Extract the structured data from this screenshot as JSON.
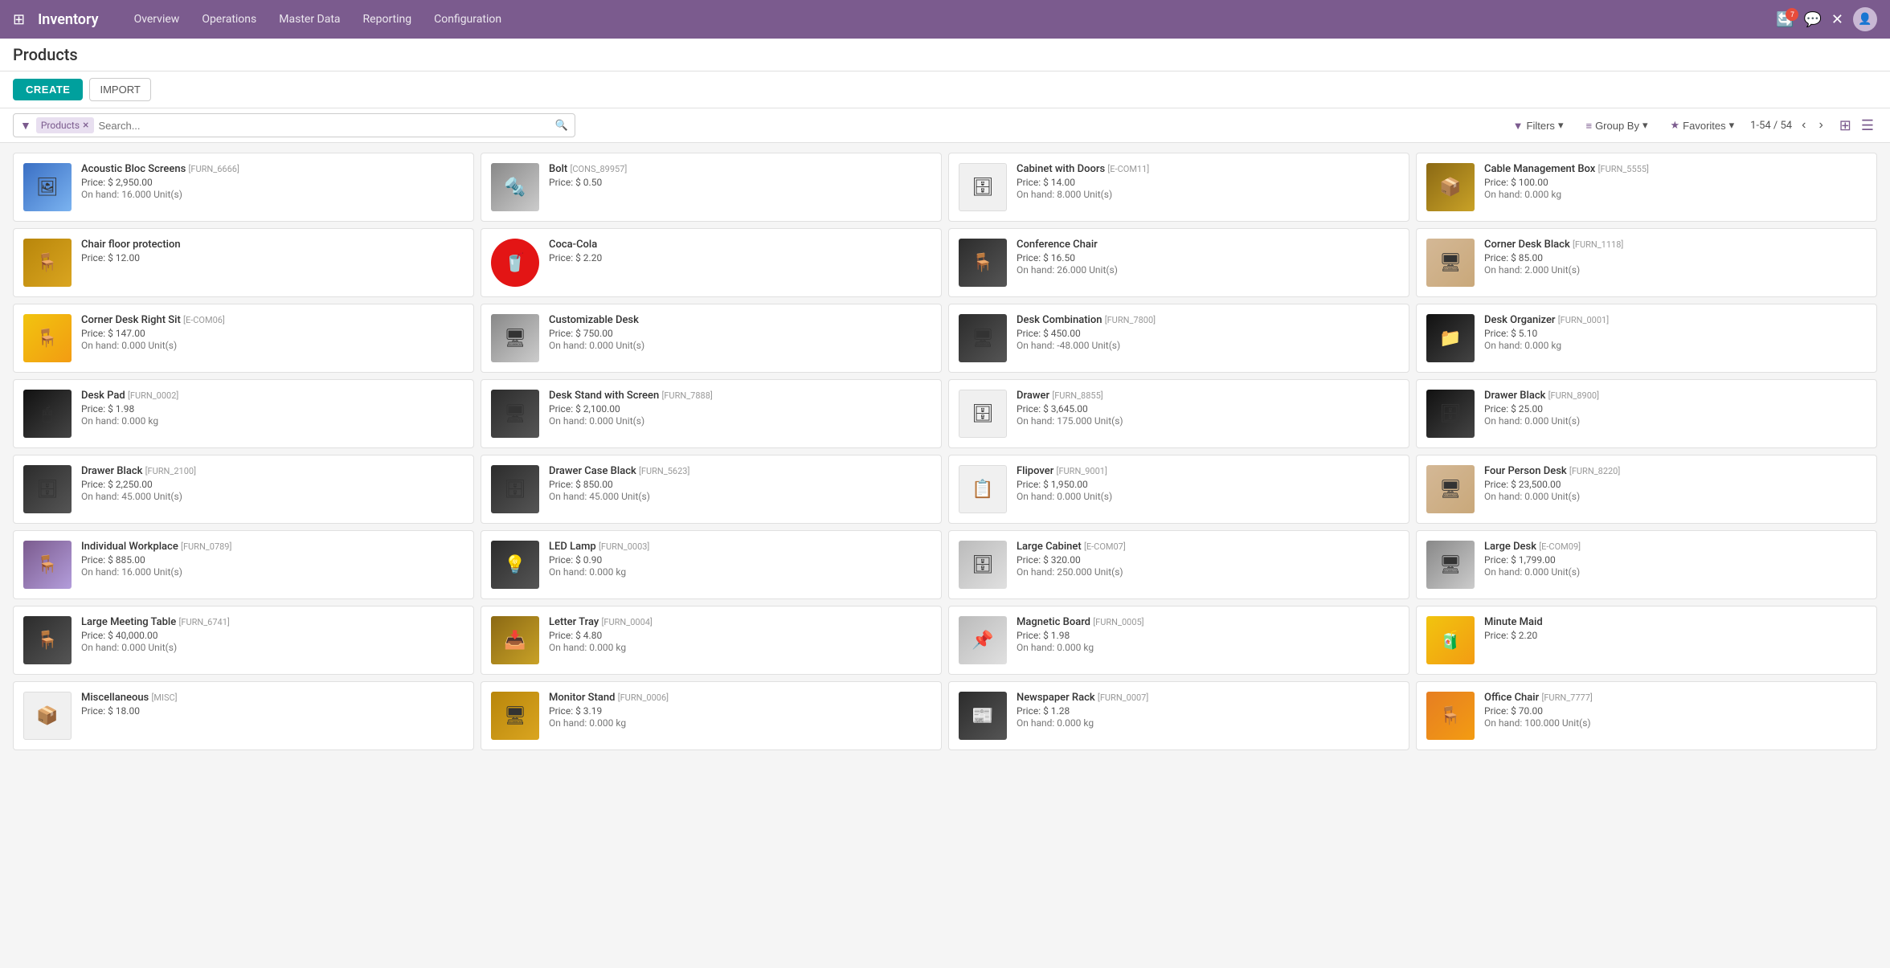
{
  "app": {
    "name": "Inventory",
    "nav_links": [
      "Overview",
      "Operations",
      "Master Data",
      "Reporting",
      "Configuration"
    ],
    "notification_count": "7"
  },
  "page": {
    "title": "Products",
    "create_label": "CREATE",
    "import_label": "IMPORT"
  },
  "search": {
    "tag": "Products",
    "placeholder": "Search...",
    "filters_label": "Filters",
    "group_by_label": "Group By",
    "favorites_label": "Favorites",
    "pagination": "1-54 / 54"
  },
  "products": [
    {
      "name": "Acoustic Bloc Screens",
      "code": "[FURN_6666]",
      "price": "Price: $ 2,950.00",
      "stock": "On hand: 16.000 Unit(s)",
      "thumb_color": "blue",
      "icon": "🖼"
    },
    {
      "name": "Bolt",
      "code": "[CONS_89957]",
      "price": "Price: $ 0.50",
      "stock": "",
      "thumb_color": "silver",
      "icon": "🔩"
    },
    {
      "name": "Cabinet with Doors",
      "code": "[E-COM11]",
      "price": "Price: $ 14.00",
      "stock": "On hand: 8.000 Unit(s)",
      "thumb_color": "white",
      "icon": "🗄"
    },
    {
      "name": "Cable Management Box",
      "code": "[FURN_5555]",
      "price": "Price: $ 100.00",
      "stock": "On hand: 0.000 kg",
      "thumb_color": "wood",
      "icon": "📦"
    },
    {
      "name": "Chair floor protection",
      "code": "",
      "price": "Price: $ 12.00",
      "stock": "",
      "thumb_color": "tan",
      "icon": "🪑"
    },
    {
      "name": "Coca-Cola",
      "code": "",
      "price": "Price: $ 2.20",
      "stock": "",
      "thumb_color": "cocacola",
      "icon": "🥤"
    },
    {
      "name": "Conference Chair",
      "code": "",
      "price": "Price: $ 16.50",
      "stock": "On hand: 26.000 Unit(s)",
      "thumb_color": "dark",
      "icon": "🪑"
    },
    {
      "name": "Corner Desk Black",
      "code": "[FURN_1118]",
      "price": "Price: $ 85.00",
      "stock": "On hand: 2.000 Unit(s)",
      "thumb_color": "beige",
      "icon": "🖥"
    },
    {
      "name": "Corner Desk Right Sit",
      "code": "[E-COM06]",
      "price": "Price: $ 147.00",
      "stock": "On hand: 0.000 Unit(s)",
      "thumb_color": "yellow",
      "icon": "🪑"
    },
    {
      "name": "Customizable Desk",
      "code": "",
      "price": "Price: $ 750.00",
      "stock": "On hand: 0.000 Unit(s)",
      "thumb_color": "silver",
      "icon": "🖥"
    },
    {
      "name": "Desk Combination",
      "code": "[FURN_7800]",
      "price": "Price: $ 450.00",
      "stock": "On hand: -48.000 Unit(s)",
      "thumb_color": "dark",
      "icon": "🖥"
    },
    {
      "name": "Desk Organizer",
      "code": "[FURN_0001]",
      "price": "Price: $ 5.10",
      "stock": "On hand: 0.000 kg",
      "thumb_color": "black",
      "icon": "📁"
    },
    {
      "name": "Desk Pad",
      "code": "[FURN_0002]",
      "price": "Price: $ 1.98",
      "stock": "On hand: 0.000 kg",
      "thumb_color": "black",
      "icon": "🖱"
    },
    {
      "name": "Desk Stand with Screen",
      "code": "[FURN_7888]",
      "price": "Price: $ 2,100.00",
      "stock": "On hand: 0.000 Unit(s)",
      "thumb_color": "dark",
      "icon": "🖥"
    },
    {
      "name": "Drawer",
      "code": "[FURN_8855]",
      "price": "Price: $ 3,645.00",
      "stock": "On hand: 175.000 Unit(s)",
      "thumb_color": "white",
      "icon": "🗄"
    },
    {
      "name": "Drawer Black",
      "code": "[FURN_8900]",
      "price": "Price: $ 25.00",
      "stock": "On hand: 0.000 Unit(s)",
      "thumb_color": "black",
      "icon": "🗄"
    },
    {
      "name": "Drawer Black",
      "code": "[FURN_2100]",
      "price": "Price: $ 2,250.00",
      "stock": "On hand: 45.000 Unit(s)",
      "thumb_color": "dark",
      "icon": "🗄"
    },
    {
      "name": "Drawer Case Black",
      "code": "[FURN_5623]",
      "price": "Price: $ 850.00",
      "stock": "On hand: 45.000 Unit(s)",
      "thumb_color": "dark",
      "icon": "🗄"
    },
    {
      "name": "Flipover",
      "code": "[FURN_9001]",
      "price": "Price: $ 1,950.00",
      "stock": "On hand: 0.000 Unit(s)",
      "thumb_color": "white",
      "icon": "📋"
    },
    {
      "name": "Four Person Desk",
      "code": "[FURN_8220]",
      "price": "Price: $ 23,500.00",
      "stock": "On hand: 0.000 Unit(s)",
      "thumb_color": "beige",
      "icon": "🖥"
    },
    {
      "name": "Individual Workplace",
      "code": "[FURN_0789]",
      "price": "Price: $ 885.00",
      "stock": "On hand: 16.000 Unit(s)",
      "thumb_color": "purple",
      "icon": "🪑"
    },
    {
      "name": "LED Lamp",
      "code": "[FURN_0003]",
      "price": "Price: $ 0.90",
      "stock": "On hand: 0.000 kg",
      "thumb_color": "dark",
      "icon": "💡"
    },
    {
      "name": "Large Cabinet",
      "code": "[E-COM07]",
      "price": "Price: $ 320.00",
      "stock": "On hand: 250.000 Unit(s)",
      "thumb_color": "lightgray",
      "icon": "🗄"
    },
    {
      "name": "Large Desk",
      "code": "[E-COM09]",
      "price": "Price: $ 1,799.00",
      "stock": "On hand: 0.000 Unit(s)",
      "thumb_color": "silver",
      "icon": "🖥"
    },
    {
      "name": "Large Meeting Table",
      "code": "[FURN_6741]",
      "price": "Price: $ 40,000.00",
      "stock": "On hand: 0.000 Unit(s)",
      "thumb_color": "dark",
      "icon": "🪑"
    },
    {
      "name": "Letter Tray",
      "code": "[FURN_0004]",
      "price": "Price: $ 4.80",
      "stock": "On hand: 0.000 kg",
      "thumb_color": "wood",
      "icon": "📥"
    },
    {
      "name": "Magnetic Board",
      "code": "[FURN_0005]",
      "price": "Price: $ 1.98",
      "stock": "On hand: 0.000 kg",
      "thumb_color": "lightgray",
      "icon": "📌"
    },
    {
      "name": "Minute Maid",
      "code": "",
      "price": "Price: $ 2.20",
      "stock": "",
      "thumb_color": "yellow",
      "icon": "🧃"
    },
    {
      "name": "Miscellaneous",
      "code": "[MISC]",
      "price": "Price: $ 18.00",
      "stock": "",
      "thumb_color": "white",
      "icon": "📦"
    },
    {
      "name": "Monitor Stand",
      "code": "[FURN_0006]",
      "price": "Price: $ 3.19",
      "stock": "On hand: 0.000 kg",
      "thumb_color": "tan",
      "icon": "🖥"
    },
    {
      "name": "Newspaper Rack",
      "code": "[FURN_0007]",
      "price": "Price: $ 1.28",
      "stock": "On hand: 0.000 kg",
      "thumb_color": "dark",
      "icon": "📰"
    },
    {
      "name": "Office Chair",
      "code": "[FURN_7777]",
      "price": "Price: $ 70.00",
      "stock": "On hand: 100.000 Unit(s)",
      "thumb_color": "orange",
      "icon": "🪑"
    }
  ]
}
